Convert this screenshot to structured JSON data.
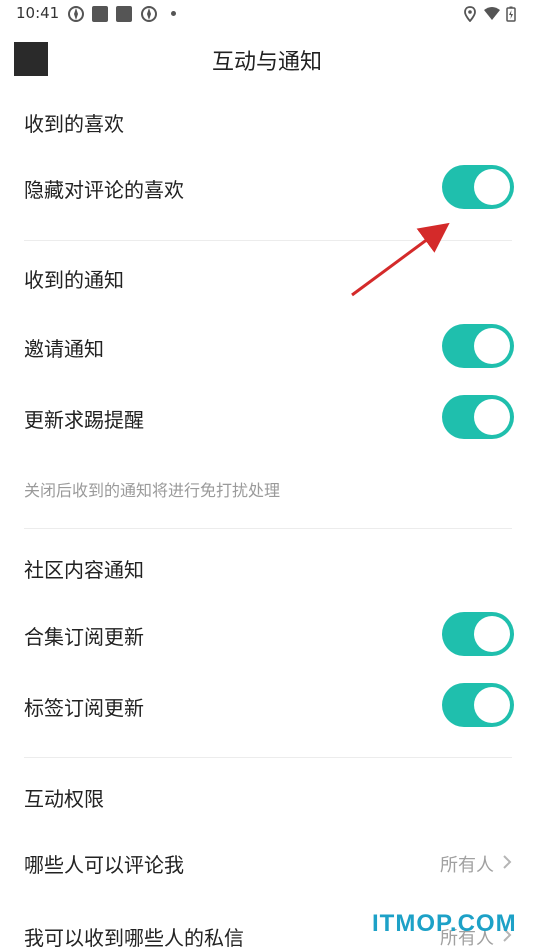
{
  "status_bar": {
    "time": "10:41"
  },
  "header": {
    "title": "互动与通知"
  },
  "sections": {
    "likes": {
      "title": "收到的喜欢",
      "hide_comment_likes": {
        "label": "隐藏对评论的喜欢",
        "on": true
      }
    },
    "notifications": {
      "title": "收到的通知",
      "invite": {
        "label": "邀请通知",
        "on": true
      },
      "update_reminder": {
        "label": "更新求踢提醒",
        "on": true
      },
      "hint": "关闭后收到的通知将进行免打扰处理"
    },
    "community": {
      "title": "社区内容通知",
      "collection_updates": {
        "label": "合集订阅更新",
        "on": true
      },
      "tag_updates": {
        "label": "标签订阅更新",
        "on": true
      }
    },
    "permissions": {
      "title": "互动权限",
      "who_can_comment": {
        "label": "哪些人可以评论我",
        "value": "所有人"
      },
      "who_can_message": {
        "label": "我可以收到哪些人的私信",
        "value": "所有人"
      }
    }
  },
  "watermark": "ITMOP.COM",
  "colors": {
    "toggle_on": "#1fbfad",
    "annotation_arrow": "#d42a2a",
    "watermark": "#1da1c7"
  },
  "icons": {
    "back": "back-placeholder-icon",
    "chevron": "chevron-right-icon"
  }
}
